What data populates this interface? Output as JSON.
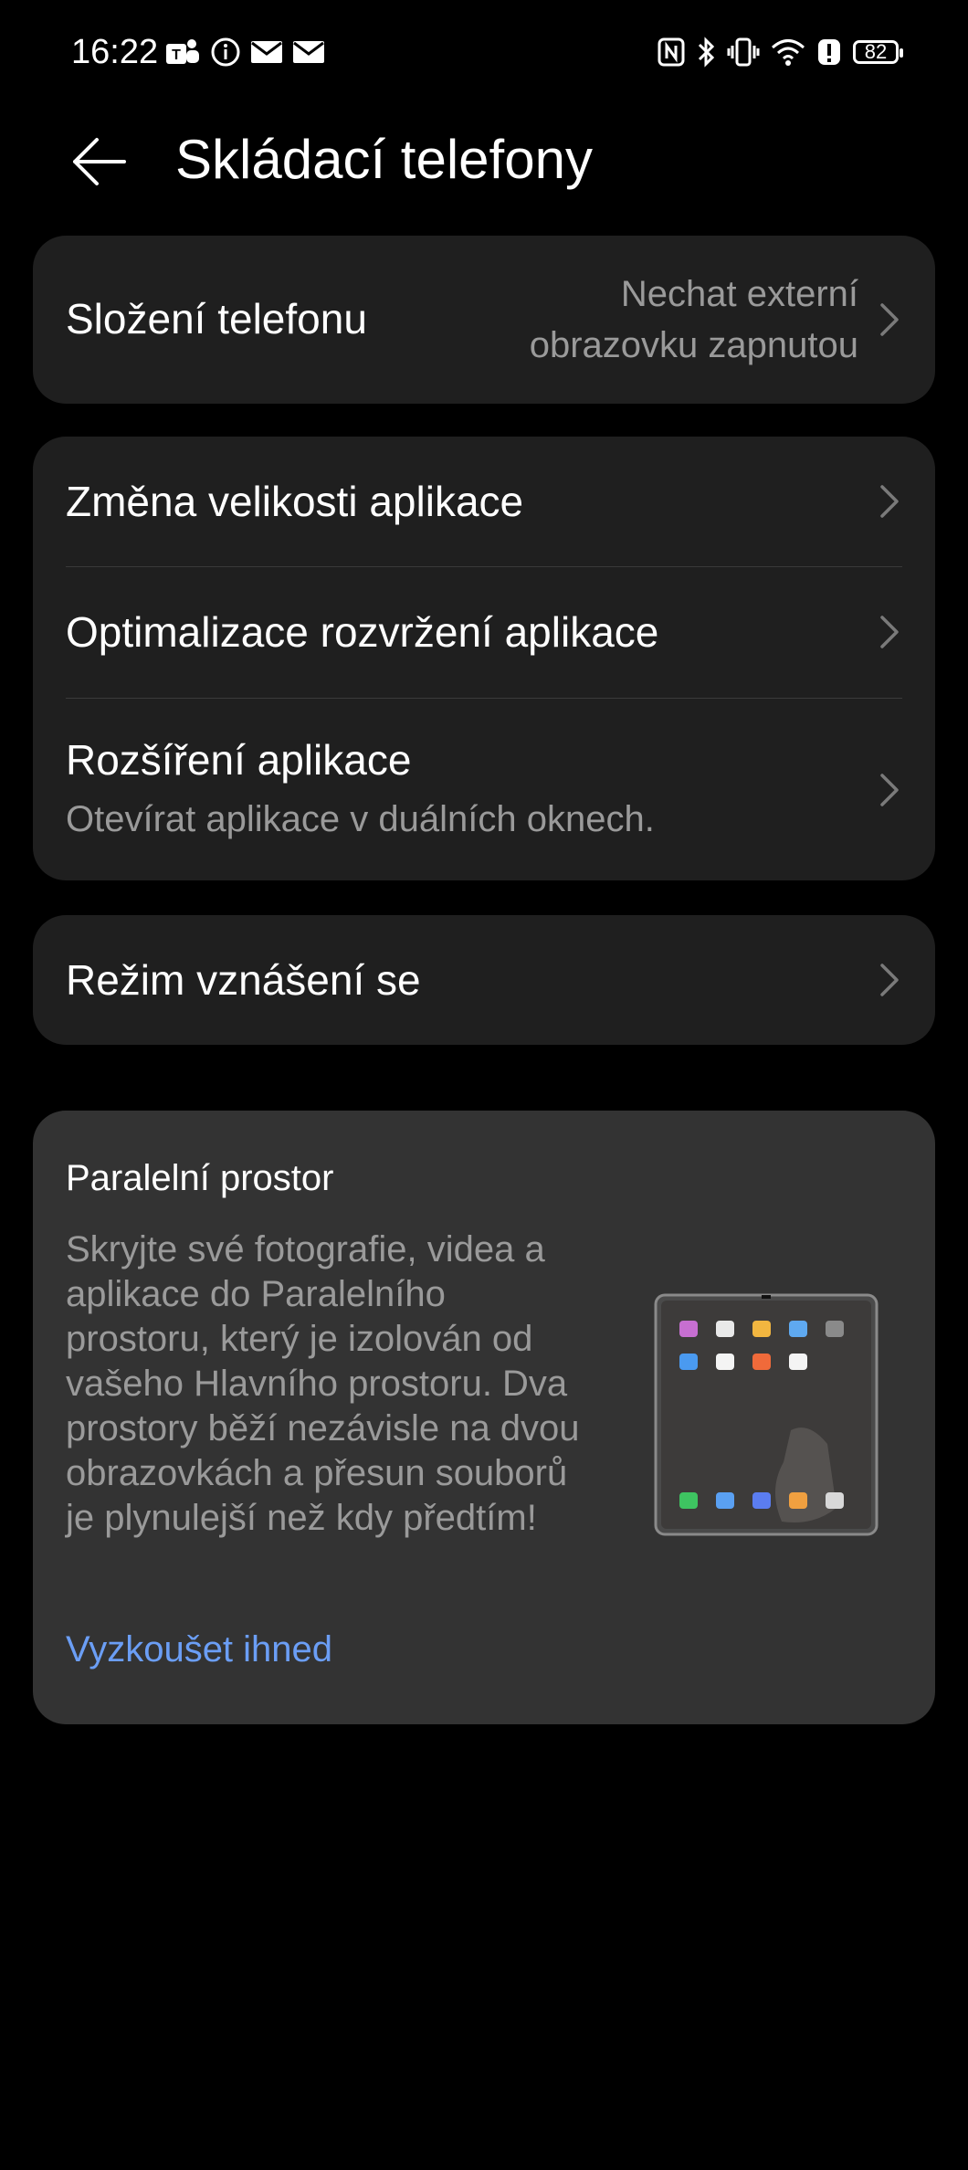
{
  "status": {
    "time": "16:22",
    "battery": "82",
    "left_icons": [
      "teams-icon",
      "info-icon",
      "mail-icon",
      "mail-icon"
    ],
    "right_icons": [
      "nfc-icon",
      "bluetooth-icon",
      "vibrate-icon",
      "wifi-icon",
      "alert-icon",
      "battery-icon"
    ]
  },
  "header": {
    "title": "Skládací telefony"
  },
  "items": {
    "fold": {
      "title": "Složení telefonu",
      "value_line1": "Nechat externí",
      "value_line2": "obrazovku zapnutou"
    },
    "resize": {
      "title": "Změna velikosti aplikace"
    },
    "layout": {
      "title": "Optimalizace rozvržení aplikace"
    },
    "extend": {
      "title": "Rozšíření aplikace",
      "subtitle": "Otevírat aplikace v duálních oknech."
    },
    "hover": {
      "title": "Režim vznášení se"
    }
  },
  "promo": {
    "title": "Paralelní prostor",
    "body": "Skryjte své fotografie, videa a aplikace do Paralelního prostoru, který je izolován od vašeho Hlavního prostoru. Dva prostory běží nezávisle na dvou obrazovkách a přesun souborů je plynulejší než kdy předtím!",
    "link": "Vyzkoušet ihned"
  },
  "colors": {
    "background": "#000000",
    "card": "#1f1f1f",
    "promo_card": "#333333",
    "secondary_text": "#9a9a9a",
    "link": "#6b9ef5"
  }
}
